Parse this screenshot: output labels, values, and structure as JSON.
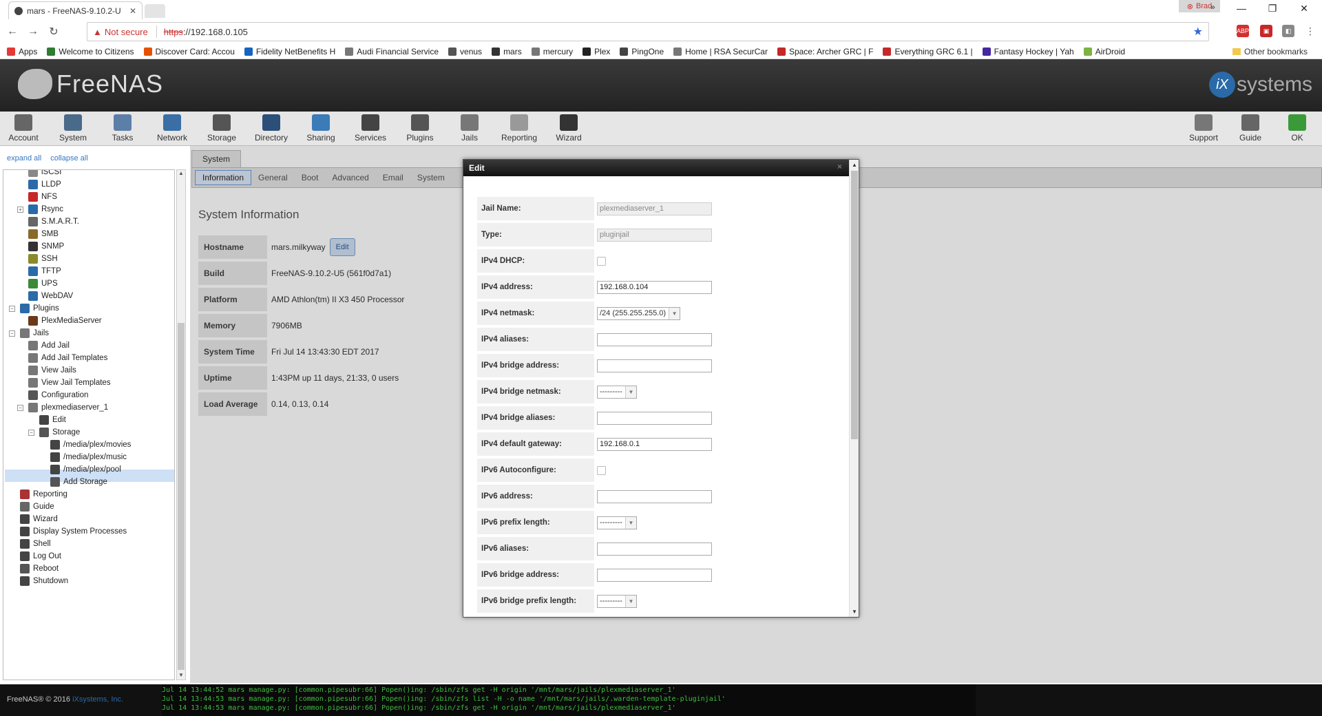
{
  "browser": {
    "tab_title": "mars - FreeNAS-9.10.2-U",
    "profile": "Brad",
    "not_secure": "Not secure",
    "url_proto": "https",
    "url_rest": "://192.168.0.105",
    "bookmarks": [
      "Apps",
      "Welcome to Citizens",
      "Discover Card: Accou",
      "Fidelity NetBenefits H",
      "Audi Financial Service",
      "venus",
      "mars",
      "mercury",
      "Plex",
      "PingOne",
      "Home | RSA SecurCar",
      "Space: Archer GRC | F",
      "Everything GRC 6.1 |",
      "Fantasy Hockey | Yah",
      "AirDroid"
    ],
    "bookmark_colors": [
      "#e53935",
      "#2e7d32",
      "#e65100",
      "#1565c0",
      "#777777",
      "#555555",
      "#333333",
      "#777777",
      "#222222",
      "#444444",
      "#777777",
      "#c62828",
      "#c62828",
      "#4527a0",
      "#7cb342"
    ],
    "other_bookmarks": "Other bookmarks",
    "more": "»"
  },
  "header": {
    "logo": "FreeNAS",
    "ix": "iX",
    "ix_rest": "systems"
  },
  "toolbar": [
    {
      "label": "Account",
      "color": "#666666"
    },
    {
      "label": "System",
      "color": "#4a6a8a"
    },
    {
      "label": "Tasks",
      "color": "#5c7fa8"
    },
    {
      "label": "Network",
      "color": "#3a6ea5"
    },
    {
      "label": "Storage",
      "color": "#555555"
    },
    {
      "label": "Directory",
      "color": "#2c4f7a"
    },
    {
      "label": "Sharing",
      "color": "#3b7bb8"
    },
    {
      "label": "Services",
      "color": "#444444"
    },
    {
      "label": "Plugins",
      "color": "#555555"
    },
    {
      "label": "Jails",
      "color": "#777777"
    },
    {
      "label": "Reporting",
      "color": "#999999"
    },
    {
      "label": "Wizard",
      "color": "#333333"
    }
  ],
  "toolbar_right": [
    {
      "label": "Support",
      "color": "#777777"
    },
    {
      "label": "Guide",
      "color": "#666666"
    },
    {
      "label": "OK",
      "color": "#3a9a3a"
    }
  ],
  "sidebar": {
    "expand_all": "expand all",
    "collapse_all": "collapse all",
    "items": [
      "iSCSI",
      "LLDP",
      "NFS",
      "Rsync",
      "S.M.A.R.T.",
      "SMB",
      "SNMP",
      "SSH",
      "TFTP",
      "UPS",
      "WebDAV",
      "Plugins",
      "PlexMediaServer",
      "Jails",
      "Add Jail",
      "Add Jail Templates",
      "View Jails",
      "View Jail Templates",
      "Configuration",
      "plexmediaserver_1",
      "Edit",
      "Storage",
      "/media/plex/movies",
      "/media/plex/music",
      "/media/plex/pool",
      "Add Storage",
      "Reporting",
      "Guide",
      "Wizard",
      "Display System Processes",
      "Shell",
      "Log Out",
      "Reboot",
      "Shutdown"
    ]
  },
  "main": {
    "tab": "System",
    "subtabs": [
      "Information",
      "General",
      "Boot",
      "Advanced",
      "Email",
      "System"
    ],
    "title": "System Information",
    "edit_label": "Edit",
    "rows": [
      {
        "k": "Hostname",
        "v": "mars.milkyway"
      },
      {
        "k": "Build",
        "v": "FreeNAS-9.10.2-U5 (561f0d7a1)"
      },
      {
        "k": "Platform",
        "v": "AMD Athlon(tm) II X3 450 Processor"
      },
      {
        "k": "Memory",
        "v": "7906MB"
      },
      {
        "k": "System Time",
        "v": "Fri Jul 14 13:43:30 EDT 2017"
      },
      {
        "k": "Uptime",
        "v": "1:43PM up 11 days, 21:33, 0 users"
      },
      {
        "k": "Load Average",
        "v": "0.14, 0.13, 0.14"
      }
    ]
  },
  "modal": {
    "title": "Edit",
    "close": "×",
    "fields": [
      {
        "k": "Jail Name:",
        "type": "ro",
        "v": "plexmediaserver_1"
      },
      {
        "k": "Type:",
        "type": "ro",
        "v": "pluginjail"
      },
      {
        "k": "IPv4 DHCP:",
        "type": "chk",
        "v": ""
      },
      {
        "k": "IPv4 address:",
        "type": "text",
        "v": "192.168.0.104"
      },
      {
        "k": "IPv4 netmask:",
        "type": "sel",
        "v": "/24 (255.255.255.0)"
      },
      {
        "k": "IPv4 aliases:",
        "type": "text",
        "v": ""
      },
      {
        "k": "IPv4 bridge address:",
        "type": "text",
        "v": ""
      },
      {
        "k": "IPv4 bridge netmask:",
        "type": "sel",
        "v": "---------"
      },
      {
        "k": "IPv4 bridge aliases:",
        "type": "text",
        "v": ""
      },
      {
        "k": "IPv4 default gateway:",
        "type": "text",
        "v": "192.168.0.1"
      },
      {
        "k": "IPv6 Autoconfigure:",
        "type": "chk",
        "v": ""
      },
      {
        "k": "IPv6 address:",
        "type": "text",
        "v": ""
      },
      {
        "k": "IPv6 prefix length:",
        "type": "sel",
        "v": "---------"
      },
      {
        "k": "IPv6 aliases:",
        "type": "text",
        "v": ""
      },
      {
        "k": "IPv6 bridge address:",
        "type": "text",
        "v": ""
      },
      {
        "k": "IPv6 bridge prefix length:",
        "type": "sel",
        "v": "---------"
      }
    ]
  },
  "footer": {
    "copy": "FreeNAS® © 2016",
    "copy_ix": "iXsystems, Inc.",
    "console": [
      "Jul 14 13:44:52 mars manage.py: [common.pipesubr:66] Popen()ing: /sbin/zfs get -H origin '/mnt/mars/jails/plexmediaserver_1'",
      "Jul 14 13:44:53 mars manage.py: [common.pipesubr:66] Popen()ing: /sbin/zfs list -H -o name '/mnt/mars/jails/.warden-template-pluginjail'",
      "Jul 14 13:44:53 mars manage.py: [common.pipesubr:66] Popen()ing: /sbin/zfs get -H origin '/mnt/mars/jails/plexmediaserver_1'"
    ]
  }
}
